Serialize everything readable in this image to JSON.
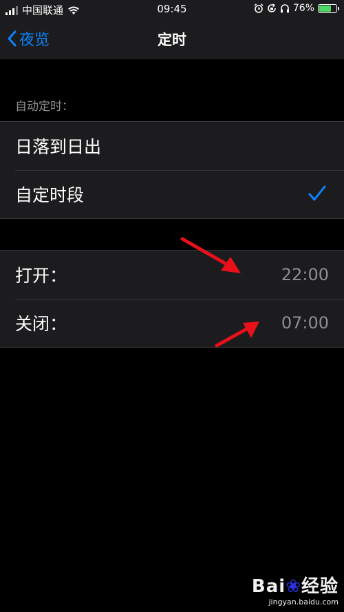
{
  "status_bar": {
    "carrier": "中国联通",
    "time": "09:45",
    "battery_percent": "76%",
    "battery_level": 0.76,
    "icons": [
      "signal-icon",
      "wifi-icon",
      "alarm-icon",
      "orientation-lock-icon",
      "headphones-icon",
      "battery-charging-icon"
    ]
  },
  "nav": {
    "back_label": "夜览",
    "title": "定时"
  },
  "auto_schedule": {
    "header": "自动定时：",
    "options": [
      {
        "label": "日落到日出",
        "selected": false
      },
      {
        "label": "自定时段",
        "selected": true
      }
    ]
  },
  "schedule_times": {
    "on_label": "打开：",
    "on_value": "22:00",
    "off_label": "关闭：",
    "off_value": "07:00"
  },
  "watermark": {
    "logo": "Bai",
    "logo_suffix": "经验",
    "site": "jingyan.baidu.com"
  },
  "colors": {
    "accent": "#0a84ff",
    "arrow": "#e8101a",
    "cell_bg": "#1c1c1e"
  }
}
